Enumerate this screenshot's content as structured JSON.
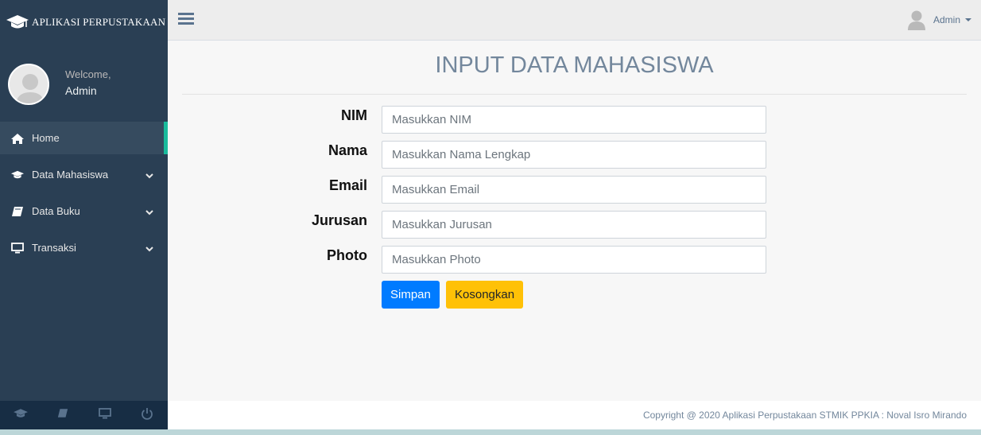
{
  "brand": {
    "title": "APLIKASI PERPUSTAKAAN",
    "icon": "graduation-cap-icon"
  },
  "profile": {
    "welcome": "Welcome,",
    "name": "Admin"
  },
  "menu": [
    {
      "label": "Home",
      "icon": "home-icon",
      "active": true,
      "has_submenu": false
    },
    {
      "label": "Data Mahasiswa",
      "icon": "graduation-cap-icon",
      "active": false,
      "has_submenu": true
    },
    {
      "label": "Data Buku",
      "icon": "book-icon",
      "active": false,
      "has_submenu": true
    },
    {
      "label": "Transaksi",
      "icon": "desktop-icon",
      "active": false,
      "has_submenu": true
    }
  ],
  "sidebar_footer": [
    "graduation-cap-icon",
    "book-icon",
    "desktop-icon",
    "power-icon"
  ],
  "topnav": {
    "user_name": "Admin"
  },
  "page": {
    "title": "INPUT DATA MAHASISWA"
  },
  "form": {
    "fields": [
      {
        "label": "NIM",
        "placeholder": "Masukkan NIM",
        "value": ""
      },
      {
        "label": "Nama",
        "placeholder": "Masukkan Nama Lengkap",
        "value": ""
      },
      {
        "label": "Email",
        "placeholder": "Masukkan Email",
        "value": ""
      },
      {
        "label": "Jurusan",
        "placeholder": "Masukkan Jurusan",
        "value": ""
      },
      {
        "label": "Photo",
        "placeholder": "Masukkan Photo",
        "value": ""
      }
    ],
    "submit_label": "Simpan",
    "reset_label": "Kosongkan"
  },
  "footer": {
    "copyright": "Copyright @ 2020 Aplikasi Perpustakaan STMIK PPKIA : Noval Isro Mirando"
  },
  "colors": {
    "sidebar_bg": "#2a3f54",
    "active_accent": "#1abb9c",
    "primary": "#007bff",
    "warning": "#ffc107",
    "title": "#73879c"
  }
}
